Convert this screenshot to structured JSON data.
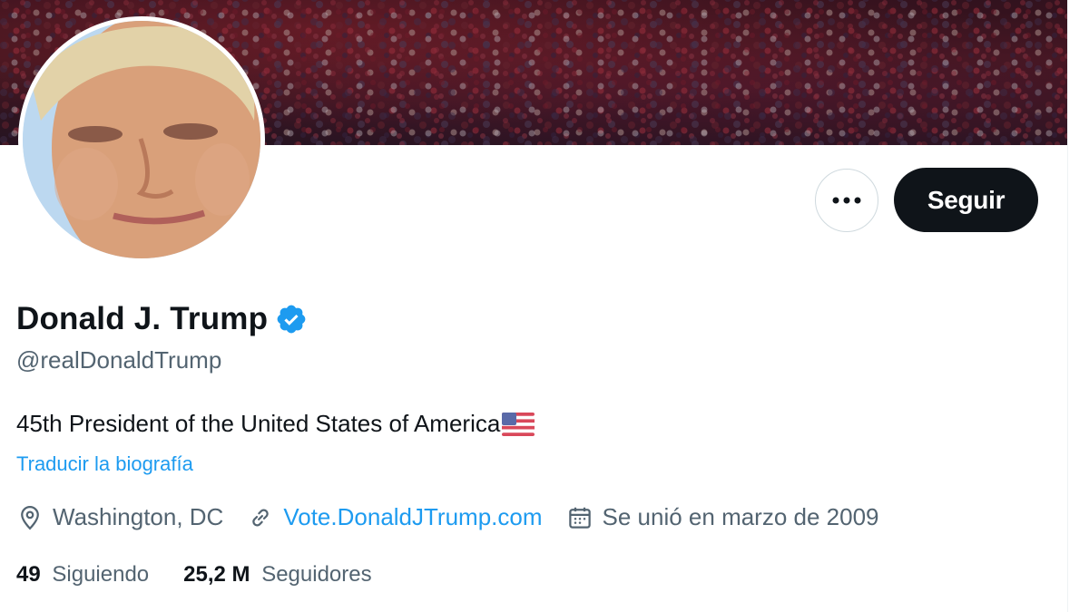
{
  "profile": {
    "name": "Donald J. Trump",
    "handle": "@realDonaldTrump",
    "bio": "45th President of the United States of America",
    "translate_label": "Traducir la biografía",
    "location": "Washington, DC",
    "website": "Vote.DonaldJTrump.com",
    "joined": "Se unió en marzo de 2009",
    "following_count": "49",
    "following_label": "Siguiendo",
    "followers_count": "25,2 M",
    "followers_label": "Seguidores"
  },
  "actions": {
    "follow_label": "Seguir",
    "more_icon": "more-horizontal-icon"
  },
  "icons": {
    "verified": "verified-badge-icon",
    "flag": "us-flag-emoji",
    "location": "location-pin-icon",
    "link": "link-icon",
    "calendar": "calendar-icon"
  },
  "colors": {
    "accent": "#1d9bf0",
    "text": "#0f1419",
    "secondary": "#536471",
    "button_dark": "#0f1419"
  }
}
